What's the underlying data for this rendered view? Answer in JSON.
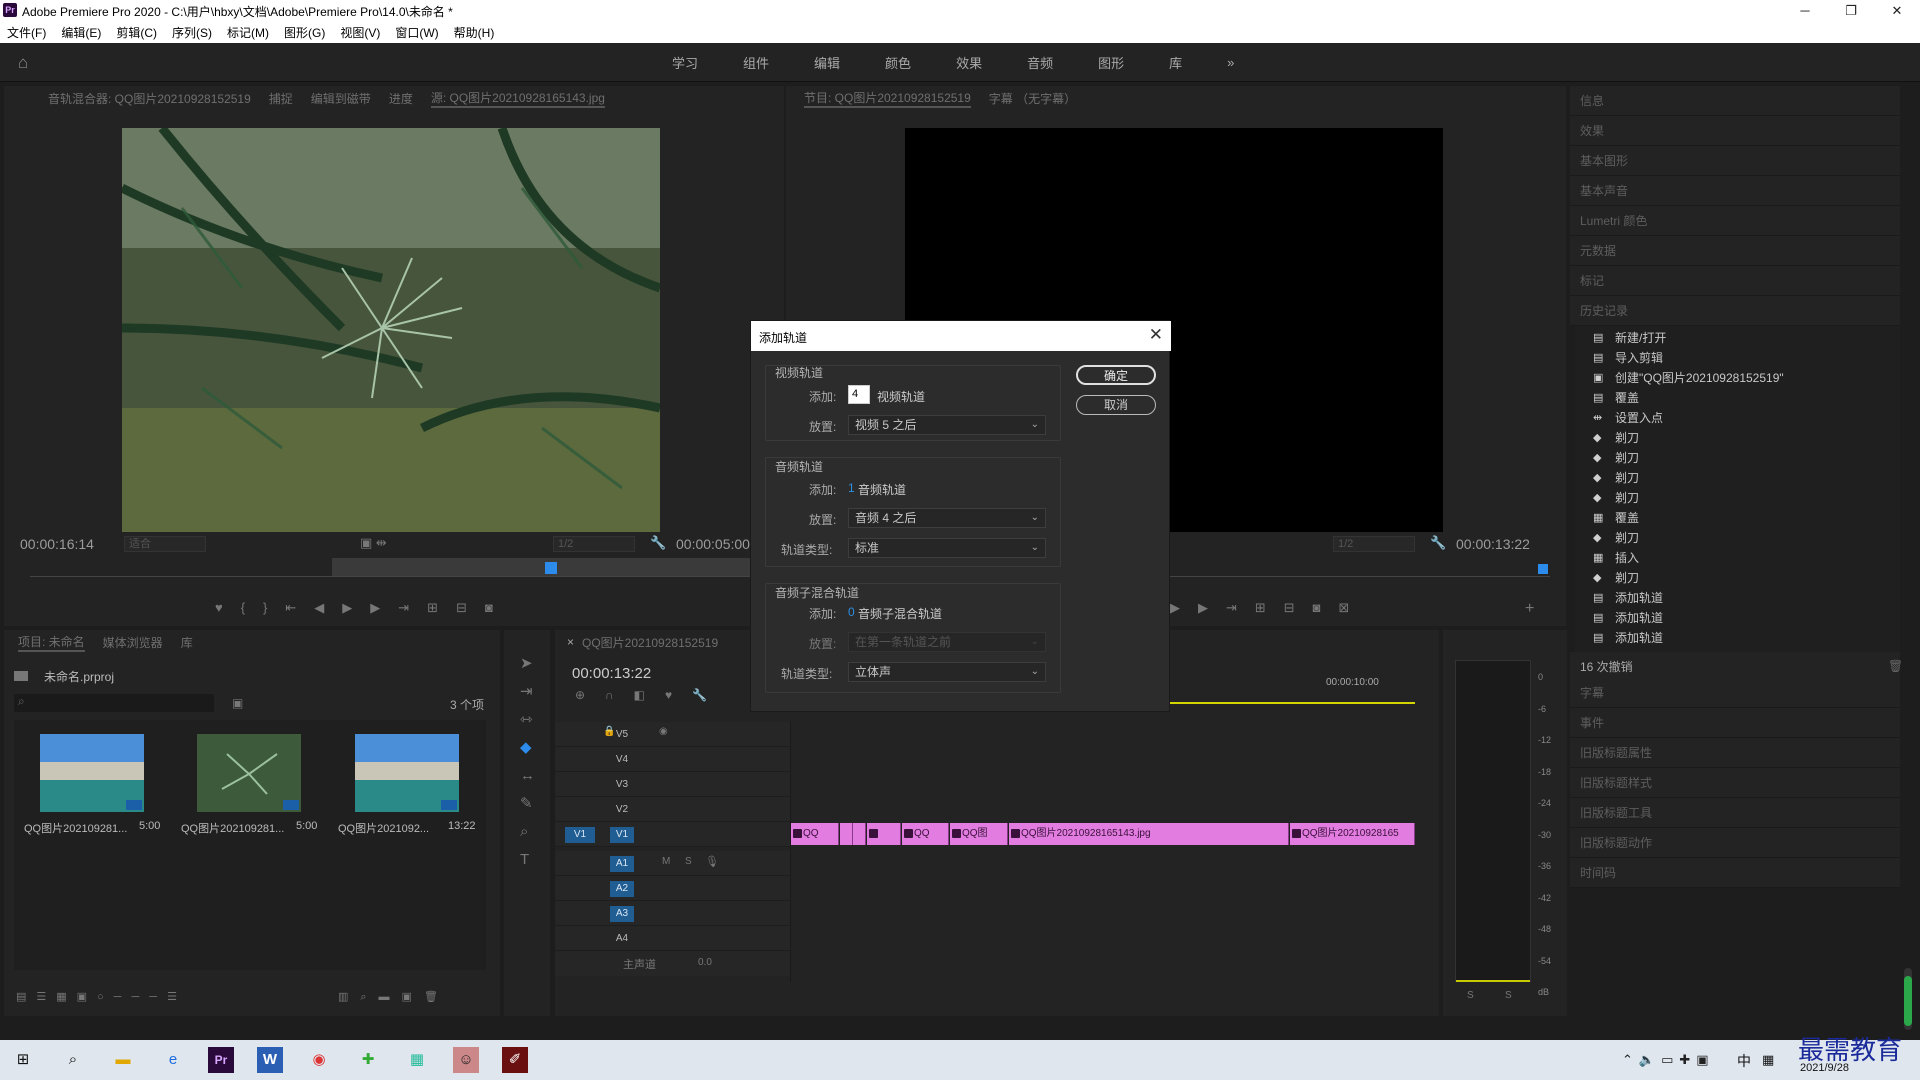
{
  "window": {
    "title": "Adobe Premiere Pro 2020 - C:\\用户\\hbxy\\文档\\Adobe\\Premiere Pro\\14.0\\未命名 *",
    "min": "─",
    "max": "❐",
    "close": "✕"
  },
  "menu": [
    "文件(F)",
    "编辑(E)",
    "剪辑(C)",
    "序列(S)",
    "标记(M)",
    "图形(G)",
    "视图(V)",
    "窗口(W)",
    "帮助(H)"
  ],
  "workspaces": [
    "学习",
    "组件",
    "编辑",
    "颜色",
    "效果",
    "音频",
    "图形",
    "库"
  ],
  "workspace_more": "»",
  "source_panel": {
    "tabs": [
      "音轨混合器: QQ图片20210928152519",
      "捕捉",
      "编辑到磁带",
      "进度",
      "源: QQ图片20210928165143.jpg"
    ],
    "timecode_left": "00:00:16:14",
    "fit": "适合",
    "timecode_right": "00:00:05:00",
    "ratio": "1/2"
  },
  "program_panel": {
    "tabs": [
      "节目: QQ图片20210928152519",
      "字幕 （无字幕）"
    ],
    "timecode_right": "00:00:13:22",
    "ratio": "1/2"
  },
  "project_panel": {
    "tabs": [
      "项目: 未命名",
      "媒体浏览器",
      "库"
    ],
    "file": "未命名.prproj",
    "count": "3 个项",
    "items": [
      {
        "name": "QQ图片202109281...",
        "dur": "5:00"
      },
      {
        "name": "QQ图片202109281...",
        "dur": "5:00"
      },
      {
        "name": "QQ图片2021092...",
        "dur": "13:22"
      }
    ]
  },
  "timeline": {
    "tab": "QQ图片20210928152519",
    "timecode": "00:00:13:22",
    "ruler_label": "00:00:10:00",
    "video_tracks": [
      "V5",
      "V4",
      "V3",
      "V2",
      "V1"
    ],
    "audio_tracks": [
      "A1",
      "A2",
      "A3",
      "A4"
    ],
    "master": "主声道",
    "master_val": "0.0",
    "v1_source": "V1",
    "m": "M",
    "s": "S",
    "clips": [
      "QQ",
      "",
      "",
      "QQ",
      "QQ图",
      "QQ图片20210928165143.jpg",
      "QQ图片20210928165"
    ]
  },
  "meter": {
    "labels": [
      "0",
      "-6",
      "-12",
      "-18",
      "-24",
      "-30",
      "-36",
      "-42",
      "-48",
      "-54",
      "dB"
    ],
    "solo": [
      "S",
      "S"
    ]
  },
  "right_panels": {
    "top": [
      "信息",
      "效果",
      "基本图形",
      "基本声音",
      "Lumetri 颜色",
      "元数据",
      "标记"
    ],
    "history_title": "历史记录",
    "history": [
      {
        "icon": "▤",
        "label": "新建/打开"
      },
      {
        "icon": "▤",
        "label": "导入剪辑"
      },
      {
        "icon": "▣",
        "label": "创建\"QQ图片20210928152519\""
      },
      {
        "icon": "▤",
        "label": "覆盖"
      },
      {
        "icon": "⇹",
        "label": "设置入点"
      },
      {
        "icon": "◆",
        "label": "剃刀"
      },
      {
        "icon": "◆",
        "label": "剃刀"
      },
      {
        "icon": "◆",
        "label": "剃刀"
      },
      {
        "icon": "◆",
        "label": "剃刀"
      },
      {
        "icon": "▦",
        "label": "覆盖"
      },
      {
        "icon": "◆",
        "label": "剃刀"
      },
      {
        "icon": "▦",
        "label": "插入"
      },
      {
        "icon": "◆",
        "label": "剃刀"
      },
      {
        "icon": "▤",
        "label": "添加轨道"
      },
      {
        "icon": "▤",
        "label": "添加轨道"
      },
      {
        "icon": "▤",
        "label": "添加轨道"
      }
    ],
    "undo": "16 次撤销",
    "bottom": [
      "字幕",
      "事件",
      "旧版标题属性",
      "旧版标题样式",
      "旧版标题工具",
      "旧版标题动作",
      "时间码"
    ]
  },
  "dialog": {
    "title": "添加轨道",
    "close": "✕",
    "ok": "确定",
    "cancel": "取消",
    "video": {
      "group": "视频轨道",
      "add_label": "添加:",
      "add_value": "4",
      "add_suffix": "视频轨道",
      "place_label": "放置:",
      "place_value": "视频 5 之后"
    },
    "audio": {
      "group": "音频轨道",
      "add_label": "添加:",
      "add_value": "1",
      "add_suffix": "音频轨道",
      "place_label": "放置:",
      "place_value": "音频 4 之后",
      "type_label": "轨道类型:",
      "type_value": "标准"
    },
    "submix": {
      "group": "音频子混合轨道",
      "add_label": "添加:",
      "add_value": "0",
      "add_suffix": "音频子混合轨道",
      "place_label": "放置:",
      "place_value": "在第一条轨道之前",
      "type_label": "轨道类型:",
      "type_value": "立体声"
    }
  },
  "taskbar": {
    "ime": "中",
    "date": "2021/9/28",
    "watermark": "最需教育"
  }
}
